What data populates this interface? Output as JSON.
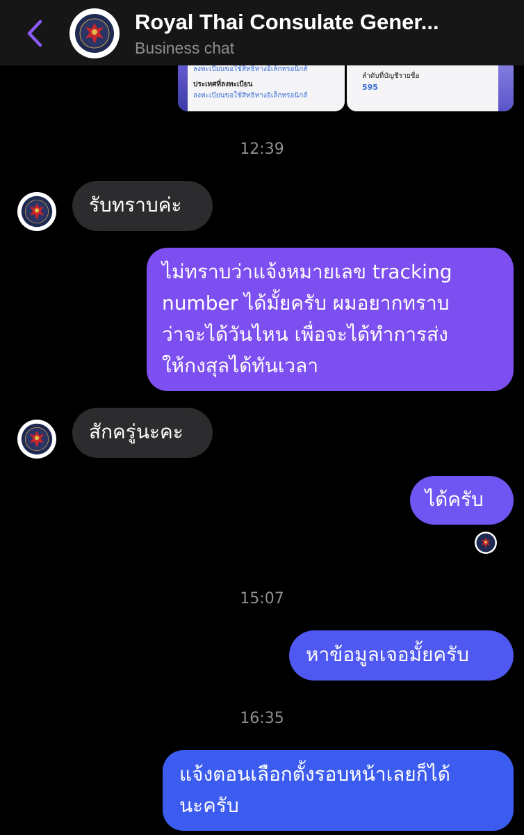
{
  "header": {
    "title": "Royal Thai Consulate Gener...",
    "subtitle": "Business chat",
    "accent": "#8b5cf6"
  },
  "previews": {
    "left_line1": "ลงทะเบียนขอใช้สิทธิทางอิเล็กทรอนิกส์",
    "left_line2": "ประเทศที่ลงทะเบียน",
    "left_line3": "ลงทะเบียนขอใช้สิทธิทางอิเล็กทรอนิกส์",
    "right_line1": "ลำดับที่บัญชีรายชื่อ",
    "right_number": "595"
  },
  "messages": [
    {
      "type": "timestamp",
      "text": "12:39"
    },
    {
      "type": "incoming",
      "text": "รับทราบค่ะ"
    },
    {
      "type": "outgoing",
      "lines": [
        "ไม่ทราบว่าแจ้งหมายเลข tracking",
        "number ได้มั้ยครับ ผมอยากทราบ",
        "ว่าจะได้วันไหน เพื่อจะได้ทำการส่ง",
        "ให้กงสุลได้ทันเวลา"
      ]
    },
    {
      "type": "incoming",
      "text": "สักครู่นะคะ"
    },
    {
      "type": "outgoing",
      "text": "ได้ครับ"
    },
    {
      "type": "timestamp",
      "text": "15:07"
    },
    {
      "type": "outgoing",
      "text": "หาข้อมูลเจอมั้ยครับ"
    },
    {
      "type": "timestamp",
      "text": "16:35"
    },
    {
      "type": "outgoing",
      "lines": [
        "แจ้งตอนเลือกตั้งรอบหน้าเลยก็ได้",
        "นะครับ"
      ]
    }
  ],
  "colors": {
    "incoming_bubble": "#2c2c2e",
    "outgoing_top": "#8a45f2",
    "outgoing_bottom": "#3a5cf0"
  }
}
